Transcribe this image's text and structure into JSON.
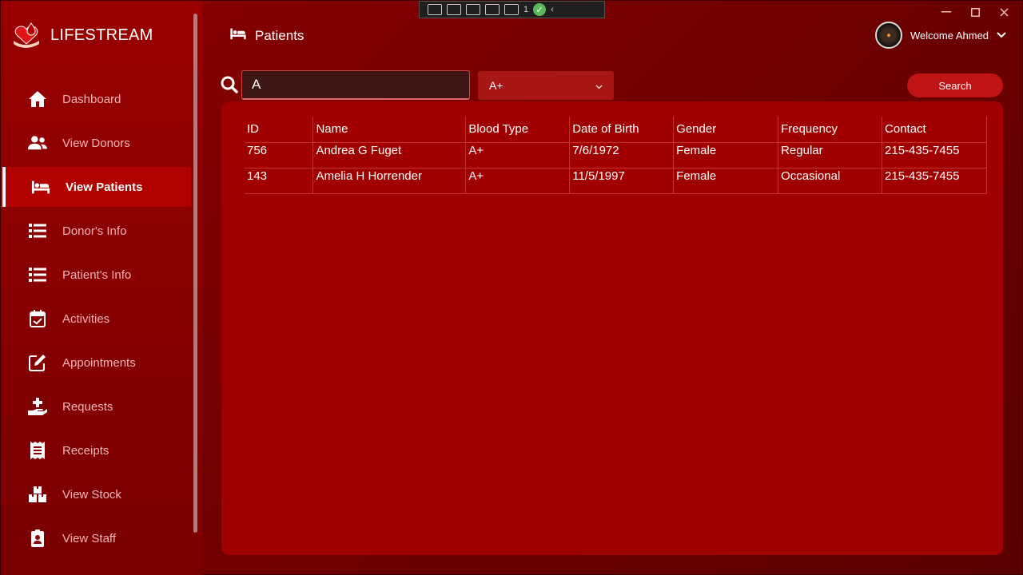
{
  "app": {
    "title": "LIFESTREAM"
  },
  "sidebar": {
    "items": [
      {
        "label": "Dashboard",
        "icon": "home-icon",
        "active": false
      },
      {
        "label": "View Donors",
        "icon": "users-icon",
        "active": false
      },
      {
        "label": "View Patients",
        "icon": "bed-icon",
        "active": true
      },
      {
        "label": "Donor's Info",
        "icon": "list-icon",
        "active": false
      },
      {
        "label": "Patient's Info",
        "icon": "list-icon",
        "active": false
      },
      {
        "label": "Activities",
        "icon": "calendar-check-icon",
        "active": false
      },
      {
        "label": "Appointments",
        "icon": "edit-icon",
        "active": false
      },
      {
        "label": "Requests",
        "icon": "hand-medical-icon",
        "active": false
      },
      {
        "label": "Receipts",
        "icon": "receipt-icon",
        "active": false
      },
      {
        "label": "View Stock",
        "icon": "boxes-icon",
        "active": false
      },
      {
        "label": "View Staff",
        "icon": "id-badge-icon",
        "active": false
      }
    ]
  },
  "toolbar": {
    "counter": "1"
  },
  "header": {
    "title": "Patients",
    "welcome": "Welcome Ahmed"
  },
  "search": {
    "value": "A",
    "blood_type": "A+",
    "button": "Search"
  },
  "table": {
    "columns": [
      "ID",
      "Name",
      "Blood Type",
      "Date of Birth",
      "Gender",
      "Frequency",
      "Contact"
    ],
    "rows": [
      [
        "756",
        "Andrea G Fuget",
        "A+",
        "7/6/1972",
        "Female",
        "Regular",
        "215-435-7455"
      ],
      [
        "143",
        "Amelia H Horrender",
        "A+",
        "11/5/1997",
        "Female",
        "Occasional",
        "215-435-7455"
      ]
    ]
  },
  "colors": {
    "background": "#8c0000",
    "panel": "#a00000",
    "accent": "#c01414",
    "nav_text": "#f3b4b4"
  }
}
